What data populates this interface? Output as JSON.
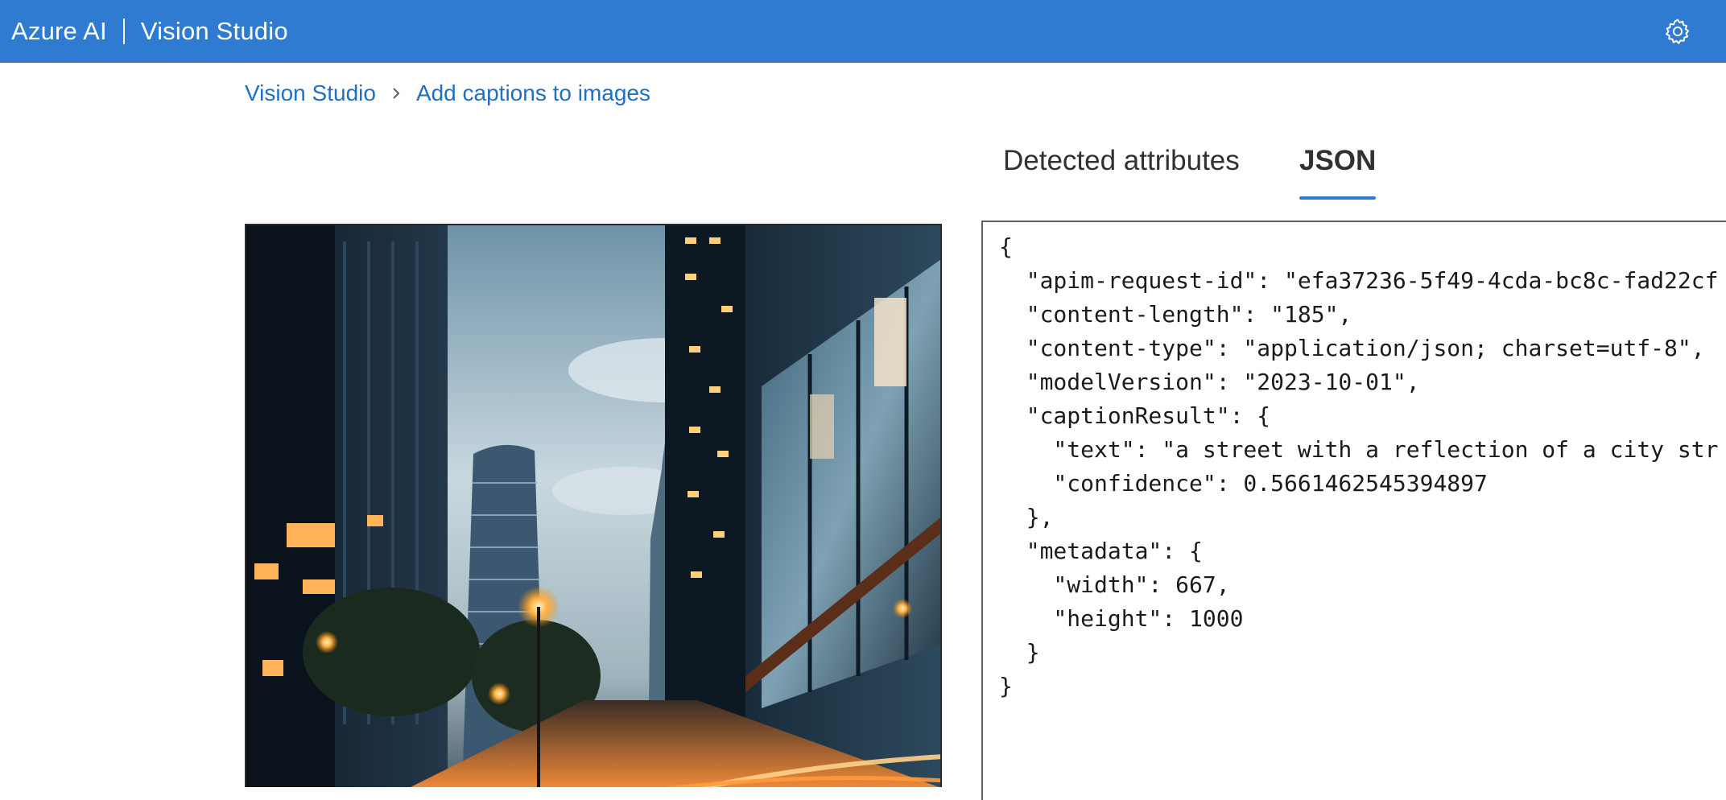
{
  "header": {
    "brand": "Azure AI",
    "product": "Vision Studio",
    "settings_icon": "gear-icon"
  },
  "breadcrumb": {
    "root": "Vision Studio",
    "current": "Add captions to images",
    "separator_icon": "chevron-right-icon"
  },
  "tabs": {
    "attributes": "Detected attributes",
    "json": "JSON",
    "selected": "JSON"
  },
  "image": {
    "icon": "city-street-photo"
  },
  "json_view": {
    "text": "{\n  \"apim-request-id\": \"efa37236-5f49-4cda-bc8c-fad22cf\n  \"content-length\": \"185\",\n  \"content-type\": \"application/json; charset=utf-8\",\n  \"modelVersion\": \"2023-10-01\",\n  \"captionResult\": {\n    \"text\": \"a street with a reflection of a city str\n    \"confidence\": 0.5661462545394897\n  },\n  \"metadata\": {\n    \"width\": 667,\n    \"height\": 1000\n  }\n}"
  },
  "colors": {
    "accent": "#2f7bd2",
    "link": "#1f6fc5"
  }
}
